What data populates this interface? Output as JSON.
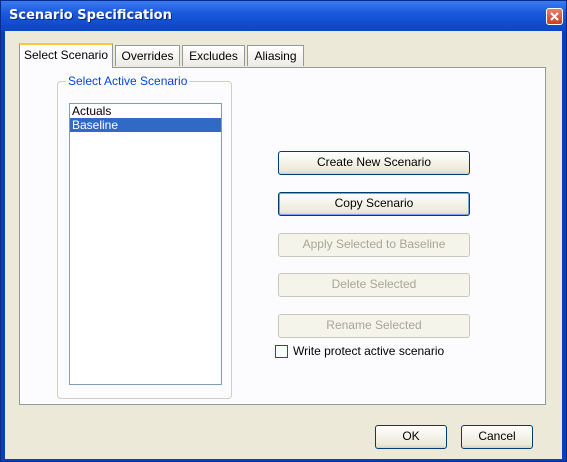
{
  "window": {
    "title": "Scenario Specification"
  },
  "tabs": [
    {
      "label": "Select Scenario",
      "active": true
    },
    {
      "label": "Overrides",
      "active": false
    },
    {
      "label": "Excludes",
      "active": false
    },
    {
      "label": "Aliasing",
      "active": false
    }
  ],
  "group": {
    "title": "Select Active Scenario"
  },
  "scenarios": [
    {
      "label": "Actuals",
      "selected": false
    },
    {
      "label": "Baseline",
      "selected": true
    }
  ],
  "actions": {
    "create_new": "Create New Scenario",
    "copy": "Copy Scenario",
    "apply_selected": "Apply Selected to Baseline",
    "delete_selected": "Delete Selected",
    "rename_selected": "Rename  Selected"
  },
  "write_protect": {
    "label": "Write protect active scenario",
    "checked": false
  },
  "footer": {
    "ok": "OK",
    "cancel": "Cancel"
  },
  "colors": {
    "titlebar": "#0c44c4",
    "selection": "#316ac5",
    "group_title": "#0046d5"
  }
}
